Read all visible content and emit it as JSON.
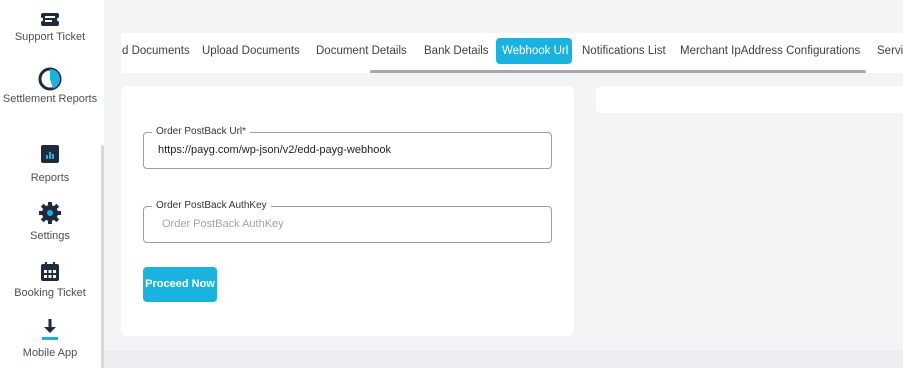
{
  "sidebar": {
    "items": [
      {
        "label": "Support Ticket",
        "icon": "ticket-icon"
      },
      {
        "label": "Settlement Reports",
        "icon": "pie-chart-icon"
      },
      {
        "label": "Reports",
        "icon": "bar-chart-icon"
      },
      {
        "label": "Settings",
        "icon": "gear-icon"
      },
      {
        "label": "Booking Ticket",
        "icon": "calendar-icon"
      },
      {
        "label": "Mobile App",
        "icon": "download-icon"
      }
    ]
  },
  "tabs": [
    {
      "label": "d Documents"
    },
    {
      "label": "Upload Documents"
    },
    {
      "label": "Document Details"
    },
    {
      "label": "Bank Details"
    },
    {
      "label": "Webhook Url"
    },
    {
      "label": "Notifications List"
    },
    {
      "label": "Merchant IpAddress Configurations"
    },
    {
      "label": "Servi"
    }
  ],
  "form": {
    "postback_url": {
      "label": "Order PostBack Url*",
      "value": "https://payg.com/wp-json/v2/edd-payg-webhook"
    },
    "postback_authkey": {
      "label": "Order PostBack AuthKey",
      "placeholder": "Order PostBack AuthKey"
    },
    "proceed_label": "Proceed Now"
  },
  "colors": {
    "accent": "#1ab3e0",
    "icon_dark": "#1f2b3a",
    "icon_accent": "#1ab3e0"
  }
}
